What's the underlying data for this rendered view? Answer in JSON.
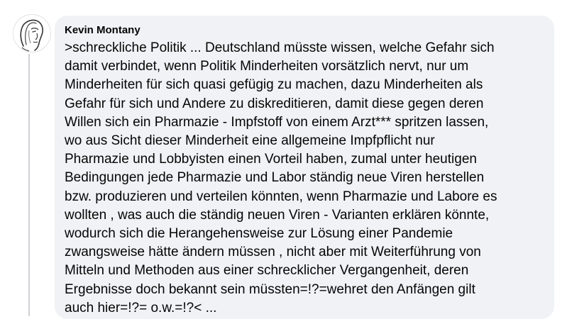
{
  "comment": {
    "author": "Kevin Montany",
    "text": ">schreckliche Politik  ... Deutschland müsste wissen, welche Gefahr sich\ndamit verbindet, wenn Politik  Minderheiten vorsätzlich nervt, nur um\nMinderheiten für sich quasi gefügig zu machen, dazu Minderheiten als\nGefahr für sich und Andere zu diskreditieren,  damit diese gegen deren\nWillen sich ein Pharmazie -  Impfstoff von einem Arzt***  spritzen lassen,\nwo aus Sicht dieser Minderheit eine allgemeine Impfpflicht  nur\nPharmazie und Lobbyisten einen Vorteil haben, zumal unter heutigen\nBedingungen jede Pharmazie und Labor ständig neue  Viren herstellen\nbzw. produzieren und verteilen könnten, wenn Pharmazie und Labore es\nwollten , was auch die ständig neuen Viren - Varianten erklären könnte,\nwodurch sich die Herangehensweise zur Lösung einer Pandemie\nzwangsweise hätte ändern müssen , nicht aber mit Weiterführung von\nMitteln und Methoden aus einer schrecklicher Vergangenheit, deren\nErgebnisse doch bekannt sein müssten=!?=wehret den Anfängen gilt\nauch hier=!?= o.w.=!?< ..."
  },
  "colors": {
    "bubble_background": "#f0f2f5",
    "text": "#050505",
    "thread_line": "#cfd2d6"
  },
  "icons": {
    "avatar": "sketched-face-profile-avatar"
  }
}
